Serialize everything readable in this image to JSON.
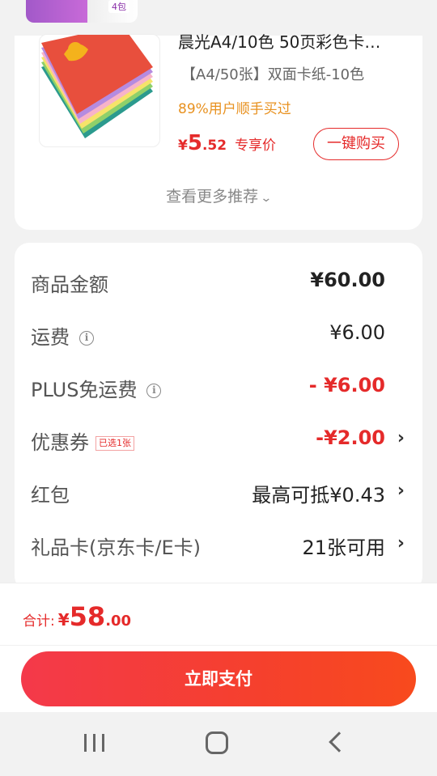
{
  "recommend": {
    "prev_thumb_label": "4包",
    "title": "晨光A4/10色 50页彩色卡…",
    "spec": "【A4/50张】双面卡纸-10色",
    "buyers": "89%用户顺手买过",
    "price_yen": "¥",
    "price_int": "5",
    "price_dec": ".52",
    "price_tag": "专享价",
    "buy_label": "一键购买",
    "more_label": "查看更多推荐",
    "more_chevron": "⌄"
  },
  "summary": {
    "rows": [
      {
        "label": "商品金额",
        "value": "¥60.00"
      },
      {
        "label": "运费",
        "value": "¥6.00",
        "info": "i"
      },
      {
        "label": "PLUS免运费",
        "value": "- ¥6.00",
        "info": "i"
      },
      {
        "label": "优惠券",
        "tag": "已选1张",
        "value": "-¥2.00",
        "arrow": "›"
      },
      {
        "label": "红包",
        "value": "最高可抵¥0.43",
        "arrow": "›"
      },
      {
        "label": "礼品卡(京东卡/E卡)",
        "value": "21张可用",
        "arrow": "›"
      }
    ]
  },
  "footer": {
    "total_label": "合计:",
    "total_yen": "¥",
    "total_int": "58",
    "total_dec": ".00",
    "pay_label": "立即支付"
  },
  "colors": {
    "accent_red": "#e52a2a",
    "buyers_orange": "#e8911f",
    "pay_gradient_start": "#f4394a",
    "pay_gradient_end": "#f84a1d"
  },
  "icons": [
    "info-icon",
    "chevron-right-icon",
    "chevron-down-icon",
    "nav-recent-icon",
    "nav-home-icon",
    "nav-back-icon"
  ]
}
